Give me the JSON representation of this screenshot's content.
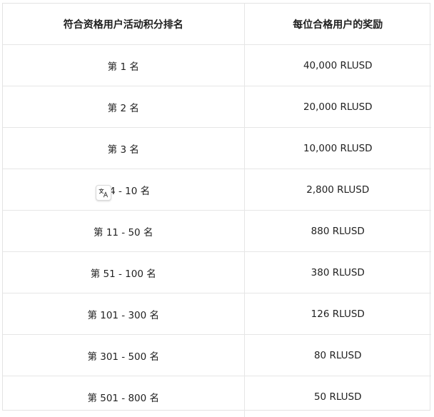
{
  "table": {
    "headers": [
      "符合资格用户活动积分排名",
      "每位合格用户的奖励"
    ],
    "rows": [
      [
        "第 1 名",
        "40,000 RLUSD"
      ],
      [
        "第 2 名",
        "20,000 RLUSD"
      ],
      [
        "第 3 名",
        "10,000 RLUSD"
      ],
      [
        "第 4 - 10 名",
        "2,800 RLUSD"
      ],
      [
        "第 11 - 50 名",
        "880 RLUSD"
      ],
      [
        "第 51 - 100 名",
        "380 RLUSD"
      ],
      [
        "第 101 - 300 名",
        "126 RLUSD"
      ],
      [
        "第 301 - 500 名",
        "80 RLUSD"
      ],
      [
        "第 501 - 800 名",
        "50 RLUSD"
      ]
    ]
  },
  "overlay": {
    "icon": "translate-icon"
  }
}
